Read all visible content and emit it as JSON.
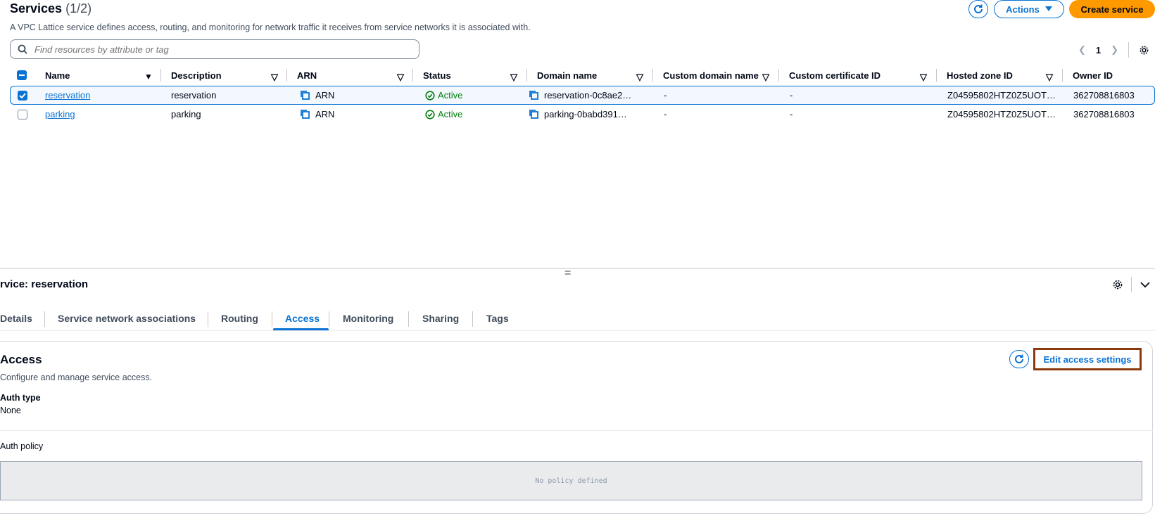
{
  "header": {
    "title": "Services",
    "count": "(1/2)",
    "subtitle": "A VPC Lattice service defines access, routing, and monitoring for network traffic it receives from service networks it is associated with.",
    "actions_label": "Actions",
    "create_label": "Create service"
  },
  "search": {
    "placeholder": "Find resources by attribute or tag"
  },
  "pagination": {
    "current_page": "1"
  },
  "table": {
    "columns": [
      "Name",
      "Description",
      "ARN",
      "Status",
      "Domain name",
      "Custom domain name",
      "Custom certificate ID",
      "Hosted zone ID",
      "Owner ID"
    ],
    "rows": [
      {
        "selected": true,
        "name": "reservation",
        "description": "reservation",
        "arn": "ARN",
        "status": "Active",
        "domain": "reservation-0c8ae2…",
        "custom_domain": "-",
        "custom_cert": "-",
        "hosted_zone": "Z04595802HTZ0Z5UOT…",
        "owner": "362708816803"
      },
      {
        "selected": false,
        "name": "parking",
        "description": "parking",
        "arn": "ARN",
        "status": "Active",
        "domain": "parking-0babd391…",
        "custom_domain": "-",
        "custom_cert": "-",
        "hosted_zone": "Z04595802HTZ0Z5UOT…",
        "owner": "362708816803"
      }
    ]
  },
  "split_panel": {
    "title": "rvice: reservation",
    "tabs": [
      "Details",
      "Service network associations",
      "Routing",
      "Access",
      "Monitoring",
      "Sharing",
      "Tags"
    ],
    "active_tab": "Access"
  },
  "access": {
    "heading": "Access",
    "description": "Configure and manage service access.",
    "edit_label": "Edit access settings",
    "auth_type_label": "Auth type",
    "auth_type_value": "None",
    "auth_policy_label": "Auth policy",
    "policy_empty": "No policy defined"
  },
  "colors": {
    "accent": "#0972d3",
    "primary": "#ff9900",
    "success": "#037f0c",
    "highlight_border": "#8b3a0e"
  }
}
